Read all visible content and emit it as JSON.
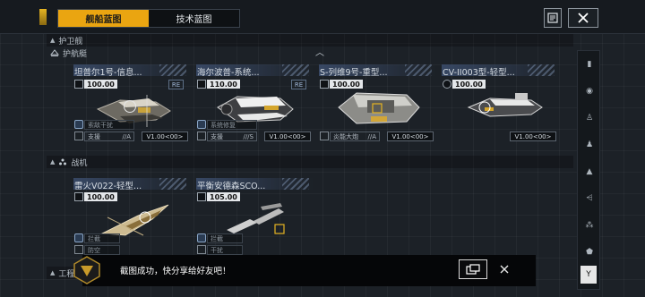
{
  "tabs": [
    {
      "label": "舰船蓝图",
      "active": true
    },
    {
      "label": "技术蓝图",
      "active": false
    }
  ],
  "header_icons": {
    "list": "list-icon",
    "close": "close-x-icon"
  },
  "sections": {
    "frigate": "护卫舰",
    "escort": "护航艇",
    "fighter": "战机",
    "engineering": "工程"
  },
  "frigate_ships": [
    {
      "name": "坦普尔1号-信息...",
      "cost": "100.00",
      "badge": "RE",
      "skill": "索敌干扰",
      "role": "支援",
      "rank": "//A",
      "level": "V1.00<00>"
    },
    {
      "name": "海尔波普-系统...",
      "cost": "110.00",
      "badge": "RE",
      "skill": "系统修复",
      "role": "支援",
      "rank": "///S",
      "level": "V1.00<00>"
    },
    {
      "name": "S-列维9号-重型...",
      "cost": "100.00",
      "badge": "",
      "skill": "",
      "role": "炎能大炮",
      "rank": "//A",
      "level": "V1.00<00>"
    },
    {
      "name": "CV-II003型-轻型...",
      "cost": "100.00",
      "badge": "",
      "skill": "",
      "role": "",
      "rank": "",
      "level": "V1.00<00>"
    }
  ],
  "fighter_ships": [
    {
      "name": "雷火V022-轻型...",
      "cost": "100.00",
      "skill": "拦截",
      "role": "防空"
    },
    {
      "name": "平衡安德森SCO...",
      "cost": "105.00",
      "skill": "拦截",
      "role": "干扰"
    }
  ],
  "toast": {
    "message": "截图成功，快分享给好友吧！",
    "share_icon": "share-window-icon",
    "close_icon": "close-x-icon"
  },
  "colors": {
    "accent": "#eaa511",
    "background": "#1c2127",
    "toast_bg": "#050608"
  }
}
